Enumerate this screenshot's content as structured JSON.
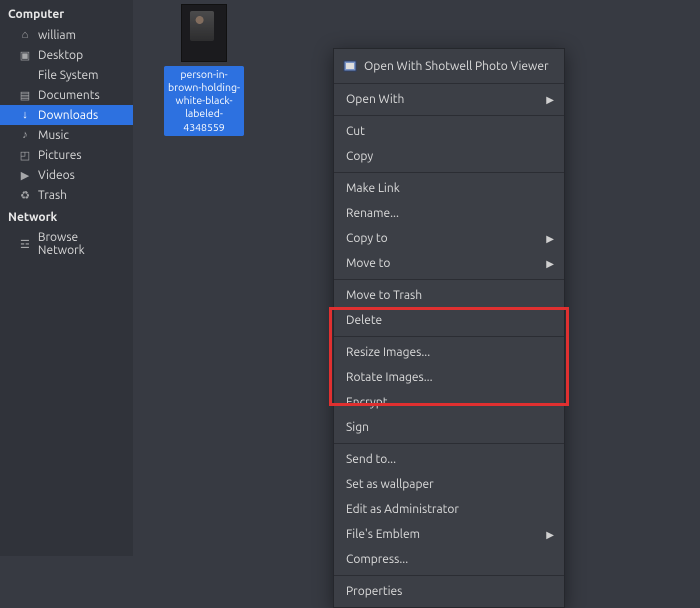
{
  "sidebar": {
    "header1": "Computer",
    "items1": [
      {
        "label": "william",
        "icon": "⌂"
      },
      {
        "label": "Desktop",
        "icon": "▣"
      },
      {
        "label": "File System",
        "icon": ""
      },
      {
        "label": "Documents",
        "icon": "▤"
      },
      {
        "label": "Downloads",
        "icon": "↓",
        "selected": true
      },
      {
        "label": "Music",
        "icon": "♪"
      },
      {
        "label": "Pictures",
        "icon": "◰"
      },
      {
        "label": "Videos",
        "icon": "▶"
      },
      {
        "label": "Trash",
        "icon": "♻"
      }
    ],
    "header2": "Network",
    "items2": [
      {
        "label": "Browse Network",
        "icon": "☲"
      }
    ]
  },
  "file": {
    "name": "person-in-brown-holding-white-black-labeled-4348559"
  },
  "menu": {
    "open_with_shotwell": "Open With Shotwell Photo Viewer",
    "open_with": "Open With",
    "cut": "Cut",
    "copy": "Copy",
    "make_link": "Make Link",
    "rename": "Rename...",
    "copy_to": "Copy to",
    "move_to": "Move to",
    "move_to_trash": "Move to Trash",
    "delete": "Delete",
    "resize_images": "Resize Images...",
    "rotate_images": "Rotate Images...",
    "encrypt": "Encrypt...",
    "sign": "Sign",
    "send_to": "Send to...",
    "set_as_wallpaper": "Set as wallpaper",
    "edit_as_admin": "Edit as Administrator",
    "files_emblem": "File's Emblem",
    "compress": "Compress...",
    "properties": "Properties"
  }
}
